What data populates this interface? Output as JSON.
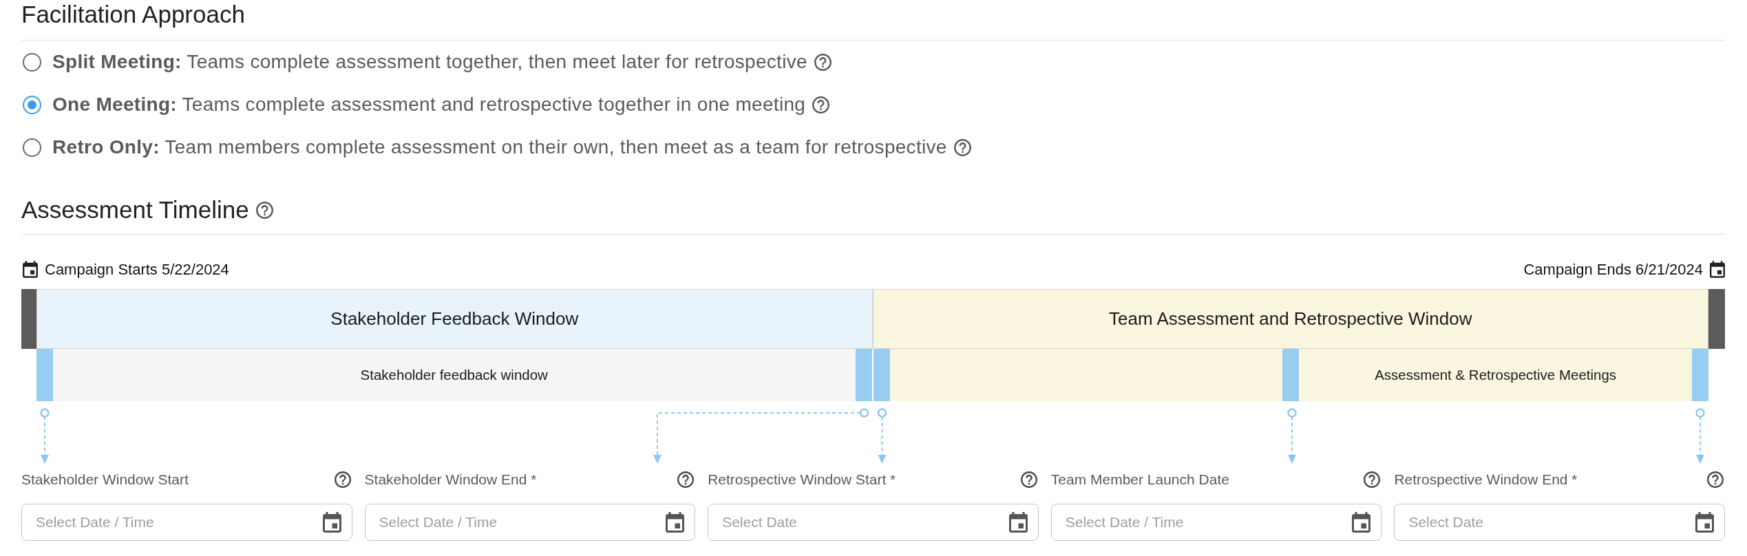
{
  "facilitation": {
    "title": "Facilitation Approach",
    "options": [
      {
        "label": "Split Meeting:",
        "description": "Teams complete assessment together, then meet later for retrospective",
        "selected": false
      },
      {
        "label": "One Meeting:",
        "description": "Teams complete assessment and retrospective together in one meeting",
        "selected": true
      },
      {
        "label": "Retro Only:",
        "description": "Team members complete assessment on their own, then meet as a team for retrospective",
        "selected": false
      }
    ]
  },
  "timeline": {
    "title": "Assessment Timeline",
    "campaign_start": "Campaign Starts 5/22/2024",
    "campaign_end": "Campaign Ends 6/21/2024",
    "windows": [
      {
        "label": "Stakeholder Feedback Window",
        "color": "#e8f3fc",
        "phases": [
          {
            "label": "Stakeholder feedback window",
            "color": "#f5f5f5"
          }
        ]
      },
      {
        "label": "Team Assessment and Retrospective Window",
        "color": "#faf6df",
        "phases": [
          {
            "color": "#faf6df"
          },
          {
            "label": "Assessment & Retrospective Meetings",
            "color": "#faf6df"
          }
        ]
      }
    ],
    "fields": [
      {
        "label": "Stakeholder Window Start",
        "placeholder": "Select Date / Time"
      },
      {
        "label": "Stakeholder Window End *",
        "placeholder": "Select Date / Time"
      },
      {
        "label": "Retrospective Window Start *",
        "placeholder": "Select Date"
      },
      {
        "label": "Team Member Launch Date",
        "placeholder": "Select Date / Time"
      },
      {
        "label": "Retrospective Window End *",
        "placeholder": "Select Date"
      }
    ]
  }
}
